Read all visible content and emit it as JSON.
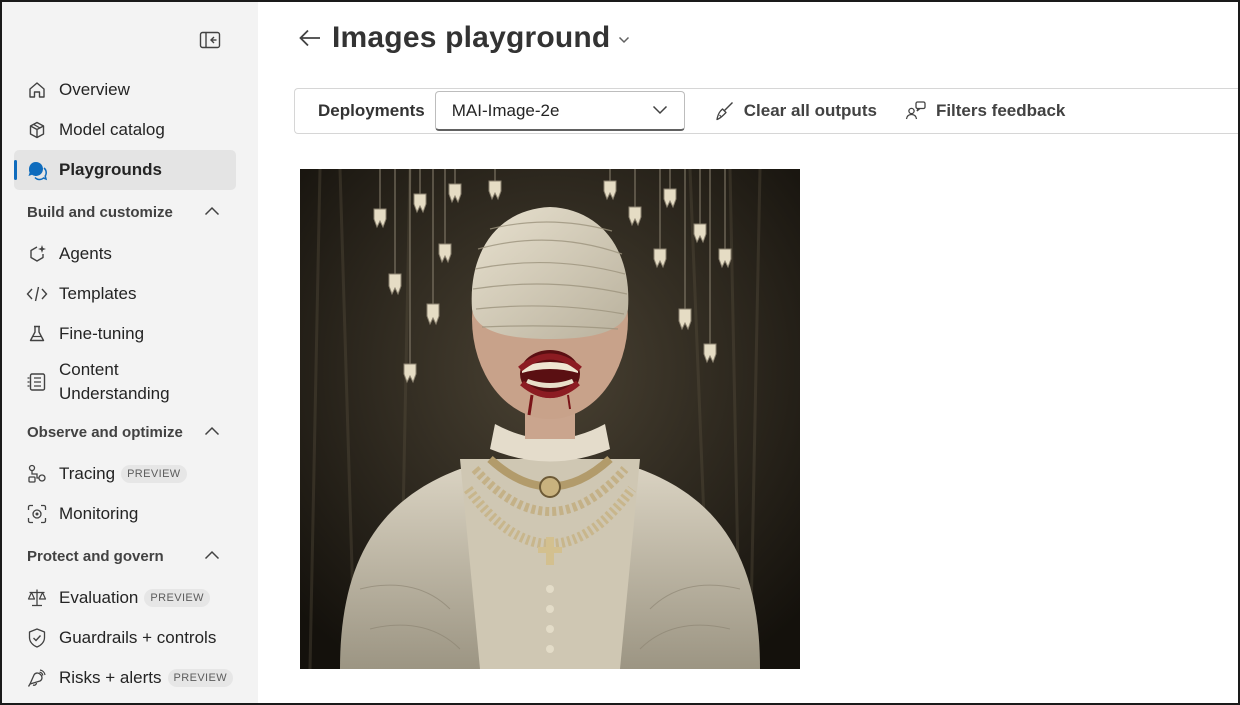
{
  "sidebar": {
    "collapse_icon": "panel-collapse-icon",
    "top_items": [
      {
        "label": "Overview",
        "icon": "home-icon"
      },
      {
        "label": "Model catalog",
        "icon": "cube-icon"
      },
      {
        "label": "Playgrounds",
        "icon": "chat-icon",
        "active": true
      }
    ],
    "sections": [
      {
        "title": "Build and customize",
        "items": [
          {
            "label": "Agents",
            "icon": "agent-sparkle-icon"
          },
          {
            "label": "Templates",
            "icon": "code-icon"
          },
          {
            "label": "Fine-tuning",
            "icon": "flask-icon"
          },
          {
            "label_line1": "Content",
            "label_line2": "Understanding",
            "icon": "document-list-icon"
          }
        ]
      },
      {
        "title": "Observe and optimize",
        "items": [
          {
            "label": "Tracing",
            "icon": "tracing-icon",
            "badge": "PREVIEW"
          },
          {
            "label": "Monitoring",
            "icon": "monitor-scan-icon"
          }
        ]
      },
      {
        "title": "Protect and govern",
        "items": [
          {
            "label": "Evaluation",
            "icon": "scales-icon",
            "badge": "PREVIEW"
          },
          {
            "label": "Guardrails + controls",
            "icon": "shield-check-icon"
          },
          {
            "label": "Risks + alerts",
            "icon": "alert-broadcast-icon",
            "badge": "PREVIEW"
          }
        ]
      }
    ]
  },
  "header": {
    "title": "Images playground",
    "back_icon": "arrow-left-icon",
    "caret_icon": "chevron-down-icon"
  },
  "toolbar": {
    "deployments_label": "Deployments",
    "deployment_value": "MAI-Image-2e",
    "clear_label": "Clear all outputs",
    "filters_label": "Filters feedback"
  },
  "output": {
    "image_icon": "generated-image"
  },
  "colors": {
    "accent": "#0f6cbd",
    "sidebar_bg": "#f3f3f3",
    "active_bg": "#e4e4e4"
  }
}
